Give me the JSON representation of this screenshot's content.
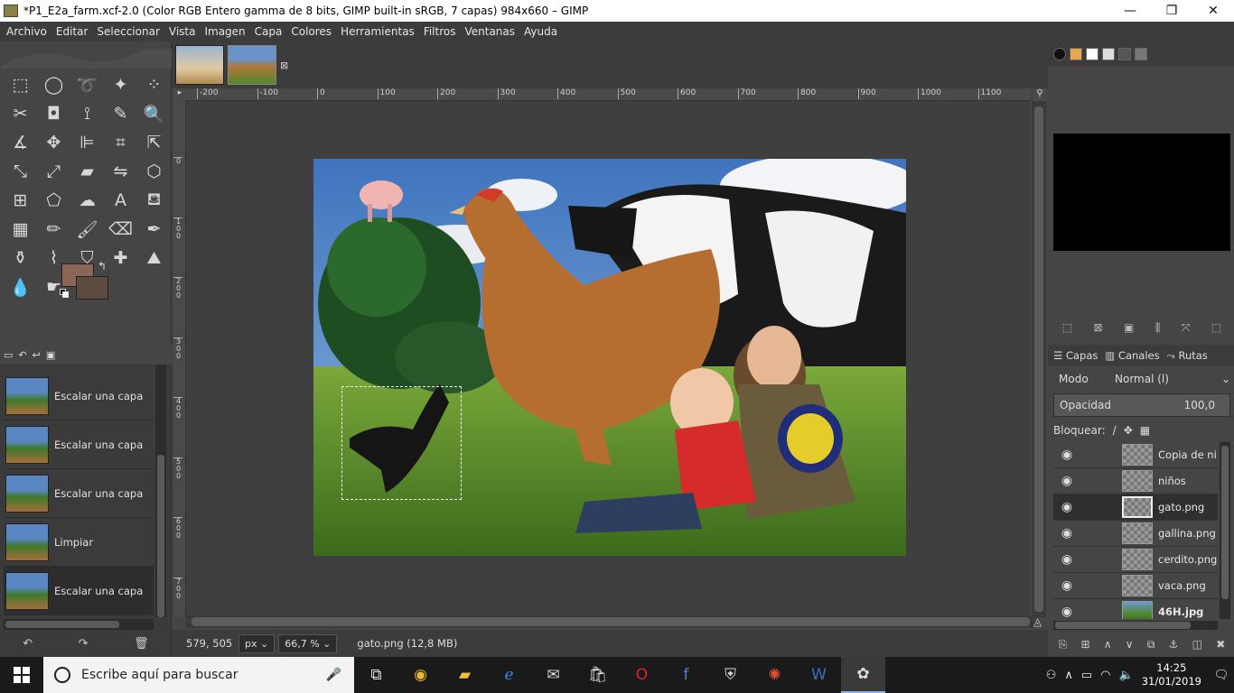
{
  "window": {
    "title": "*P1_E2a_farm.xcf-2.0 (Color RGB Entero gamma de 8 bits, GIMP built-in sRGB, 7 capas) 984x660 – GIMP",
    "minimize": "—",
    "maximize": "❐",
    "close": "✕"
  },
  "menu": [
    "Archivo",
    "Editar",
    "Seleccionar",
    "Vista",
    "Imagen",
    "Capa",
    "Colores",
    "Herramientas",
    "Filtros",
    "Ventanas",
    "Ayuda"
  ],
  "tools": [
    {
      "name": "rect-select-icon",
      "glyph": "⬚"
    },
    {
      "name": "ellipse-select-icon",
      "glyph": "◯"
    },
    {
      "name": "free-select-icon",
      "glyph": "➰"
    },
    {
      "name": "fuzzy-select-icon",
      "glyph": "✦"
    },
    {
      "name": "color-select-icon",
      "glyph": "⁘"
    },
    {
      "name": "scissors-icon",
      "glyph": "✂"
    },
    {
      "name": "foreground-select-icon",
      "glyph": "◘"
    },
    {
      "name": "paths-icon",
      "glyph": "⟟"
    },
    {
      "name": "color-picker-icon",
      "glyph": "✎"
    },
    {
      "name": "zoom-icon",
      "glyph": "🔍"
    },
    {
      "name": "measure-icon",
      "glyph": "∡"
    },
    {
      "name": "move-icon",
      "glyph": "✥"
    },
    {
      "name": "align-icon",
      "glyph": "⊫"
    },
    {
      "name": "crop-icon",
      "glyph": "⌗"
    },
    {
      "name": "unified-transform-icon",
      "glyph": "⇱"
    },
    {
      "name": "warp-transform-icon",
      "glyph": "⤡"
    },
    {
      "name": "scale-icon",
      "glyph": "⤢"
    },
    {
      "name": "shear-icon",
      "glyph": "▰"
    },
    {
      "name": "flip-icon",
      "glyph": "⇋"
    },
    {
      "name": "cage-transform-icon",
      "glyph": "⬡"
    },
    {
      "name": "handle-transform-icon",
      "glyph": "⊞"
    },
    {
      "name": "perspective-icon",
      "glyph": "⬠"
    },
    {
      "name": "gegl-icon",
      "glyph": "☁"
    },
    {
      "name": "text-tool-icon",
      "glyph": "A"
    },
    {
      "name": "bucket-fill-icon",
      "glyph": "⛾"
    },
    {
      "name": "blend-icon",
      "glyph": "▦"
    },
    {
      "name": "pencil-icon",
      "glyph": "✏"
    },
    {
      "name": "paintbrush-icon",
      "glyph": "🖌"
    },
    {
      "name": "eraser-icon",
      "glyph": "⌫"
    },
    {
      "name": "airbrush-icon",
      "glyph": "✒"
    },
    {
      "name": "ink-icon",
      "glyph": "⚱"
    },
    {
      "name": "mypaint-icon",
      "glyph": "⌇"
    },
    {
      "name": "clone-icon",
      "glyph": "⛉"
    },
    {
      "name": "heal-icon",
      "glyph": "✚"
    },
    {
      "name": "perspective-clone-icon",
      "glyph": "⛰"
    },
    {
      "name": "blur-icon",
      "glyph": "💧"
    },
    {
      "name": "smudge-icon",
      "glyph": "☛"
    },
    {
      "name": "dodge-burn-icon",
      "glyph": "⚲"
    }
  ],
  "colors": {
    "foreground": "#8a6657",
    "background": "#5d4b3f",
    "accent": "#8fb4e8"
  },
  "history": {
    "tabs": [
      "▭",
      "↶",
      "↩",
      "▣"
    ],
    "items": [
      {
        "label": "Escalar una capa"
      },
      {
        "label": "Escalar una capa"
      },
      {
        "label": "Escalar una capa"
      },
      {
        "label": "Limpiar"
      },
      {
        "label": "Escalar una capa",
        "selected": true
      }
    ],
    "bottom": [
      "↶",
      "↷",
      "🗑"
    ]
  },
  "ruler": {
    "h": [
      "-200",
      "-100",
      "0",
      "100",
      "200",
      "300",
      "400",
      "500",
      "600",
      "700",
      "800",
      "900",
      "1000",
      "1100"
    ],
    "v": [
      "0",
      "100",
      "200",
      "300",
      "400",
      "500",
      "600",
      "700"
    ]
  },
  "status": {
    "coords": "579, 505",
    "unit": "px",
    "zoom": "66,7 %",
    "text": "gato.png (12,8 MB)"
  },
  "layers": {
    "tabs": [
      "Capas",
      "Canales",
      "Rutas"
    ],
    "mode_label": "Modo",
    "mode_value": "Normal (l)",
    "opacity_label": "Opacidad",
    "opacity_value": "100,0",
    "lock_label": "Bloquear:",
    "items": [
      {
        "name": "Copia de ni"
      },
      {
        "name": "niños"
      },
      {
        "name": "gato.png",
        "selected": true
      },
      {
        "name": "gallina.png"
      },
      {
        "name": "cerdito.png"
      },
      {
        "name": "vaca.png"
      },
      {
        "name": "46H.jpg",
        "bold": true,
        "photo": true
      }
    ]
  },
  "taskbar": {
    "search_placeholder": "Escribe aquí para buscar",
    "time": "14:25",
    "date": "31/01/2019"
  }
}
